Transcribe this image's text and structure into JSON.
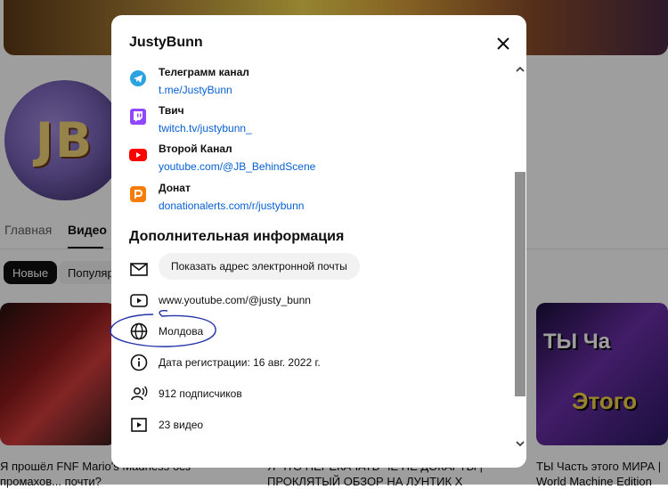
{
  "background": {
    "tabs": [
      {
        "label": "Главная"
      },
      {
        "label": "Видео"
      }
    ],
    "chips": [
      {
        "label": "Новые"
      },
      {
        "label": "Популяр"
      }
    ],
    "thumb3_text_line1": "ТЫ Ча",
    "thumb3_text_line2": "Этого",
    "video_titles": [
      {
        "line1": "Я прошёл FNF Mario's Madness без",
        "line2": "промахов... почти?"
      },
      {
        "line1": "Я ЧТО ПЕРЕКАЧАТЬ ЧЁ НЕ ДОКАРТЫ |",
        "line2": "ПРОКЛЯТЫЙ ОБЗОР НА ЛУНТИК X"
      },
      {
        "line1": "ТЫ Часть этого МИРА |",
        "line2": "World Machine Edition"
      }
    ]
  },
  "dialog": {
    "title": "JustyBunn",
    "links": [
      {
        "name": "Телеграмм канал",
        "url": "t.me/JustyBunn",
        "icon": "telegram-icon",
        "color": "#2aa3e0"
      },
      {
        "name": "Твич",
        "url": "twitch.tv/justybunn_",
        "icon": "twitch-icon",
        "color": "#9146ff"
      },
      {
        "name": "Второй Канал",
        "url": "youtube.com/@JB_BehindScene",
        "icon": "youtube-icon",
        "color": "#ff0000"
      },
      {
        "name": "Донат",
        "url": "donationalerts.com/r/justybunn",
        "icon": "donationalerts-icon",
        "color": "#f57d07"
      }
    ],
    "section_title": "Дополнительная информация",
    "email_button": "Показать адрес электронной почты",
    "info": {
      "channel_url": "www.youtube.com/@justy_bunn",
      "country": "Молдова",
      "joined": "Дата регистрации: 16 авг. 2022 г.",
      "subscribers": "912 подписчиков",
      "videos": "23 видео"
    },
    "annotation_color": "#2233aa"
  }
}
